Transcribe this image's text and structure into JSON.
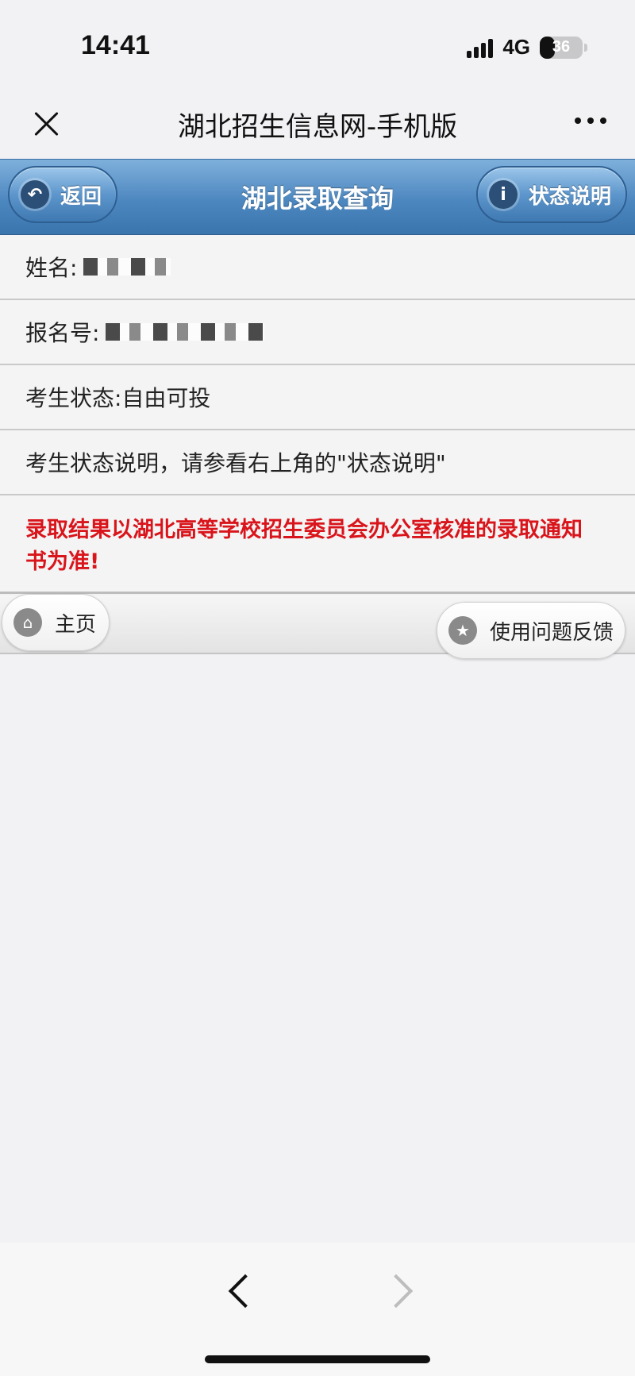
{
  "status_bar": {
    "time": "14:41",
    "network": "4G",
    "battery": "36",
    "battery_level_percent": 36
  },
  "wechat_nav": {
    "title": "湖北招生信息网-手机版",
    "close_icon": "close-icon",
    "more_icon": "more-icon"
  },
  "header": {
    "title": "湖北录取查询",
    "back_label": "返回",
    "back_icon": "undo-arrow-icon",
    "status_label": "状态说明",
    "status_icon": "info-icon",
    "bar_color": "#4d87bf"
  },
  "fields": {
    "name_label": "姓名:",
    "registration_label": "报名号:",
    "status_text": "考生状态:自由可投",
    "status_hint": "考生状态说明，请参看右上角的\"状态说明\""
  },
  "notice": {
    "text": "录取结果以湖北高等学校招生委员会办公室核准的录取通知书为准!",
    "color": "#d9141b"
  },
  "footer": {
    "home_label": "主页",
    "home_icon": "home-icon",
    "feedback_label": "使用问题反馈",
    "feedback_icon": "star-icon"
  },
  "browser_toolbar": {
    "back_icon": "chevron-left-icon",
    "forward_icon": "chevron-right-icon"
  }
}
